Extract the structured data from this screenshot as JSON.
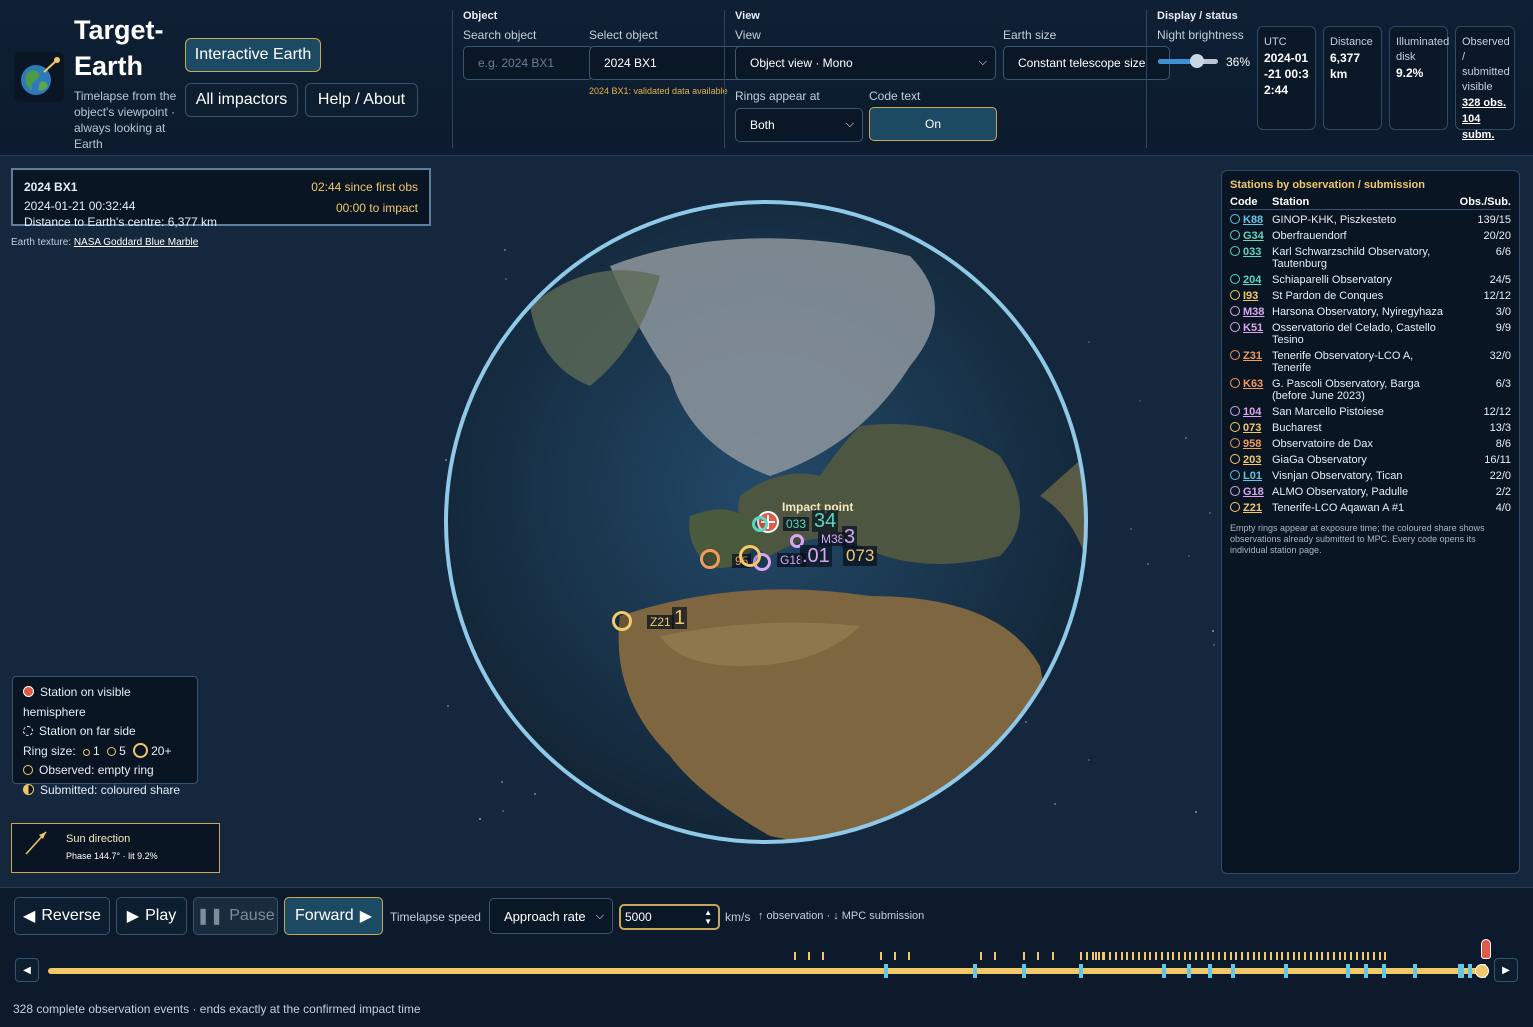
{
  "app": {
    "title": "Target-Earth",
    "subtitle": "Timelapse from the object's viewpoint · always looking at Earth"
  },
  "nav": {
    "interactive_earth": "Interactive Earth",
    "all_impactors": "All impactors",
    "help_about": "Help / About"
  },
  "object_section": {
    "title": "Object",
    "search_label": "Search object",
    "search_placeholder": "e.g. 2024 BX1",
    "select_label": "Select object",
    "select_value": "2024 BX1",
    "validated_note": "2024 BX1: validated data available"
  },
  "view_section": {
    "title": "View",
    "view_label": "View",
    "view_value": "Object view · Mono",
    "earth_size_label": "Earth size",
    "earth_size_value": "Constant telescope size",
    "rings_label": "Rings appear at",
    "rings_value": "Both",
    "code_text_label": "Code text",
    "code_text_value": "On"
  },
  "display_section": {
    "title": "Display / status",
    "night_brightness_label": "Night brightness",
    "night_brightness_value": "36%",
    "night_brightness_level": 0.36,
    "utc_label": "UTC",
    "utc_value": "2024-01-21 00:32:44",
    "distance_label": "Distance",
    "distance_value": "6,377 km",
    "illuminated_label": "Illuminated disk",
    "illuminated_value": "9.2%",
    "observed_label": "Observed / submitted visible",
    "observed_obs": "328 obs.",
    "observed_subm": "104 subm."
  },
  "infobox": {
    "object": "2024 BX1",
    "time": "2024-01-21 00:32:44",
    "distance": "Distance to Earth's centre: 6,377 km",
    "since_first": "02:44 since first obs",
    "to_impact": "00:00 to impact"
  },
  "texture": {
    "label": "Earth texture:",
    "link": "NASA Goddard Blue Marble"
  },
  "globe": {
    "impact_label": "Impact point",
    "markers": [
      {
        "code": "033",
        "color": "#5fd6c0",
        "big": "34"
      },
      {
        "code": "M38",
        "color": "#d9a7f0",
        "big": "3"
      },
      {
        "code": "95",
        "color": "#f39a5b",
        "big": ""
      },
      {
        "code": "G18",
        "color": "#d9a7f0",
        "big": ".01"
      },
      {
        "code": "073",
        "color": "#f3c96a",
        "big": ""
      },
      {
        "code": "Z21",
        "color": "#f3c96a",
        "big": "1"
      }
    ]
  },
  "legend": {
    "visible": "Station on visible hemisphere",
    "far": "Station on far side",
    "ring_size": "Ring size:",
    "sizes": [
      "1",
      "5",
      "20+"
    ],
    "observed": "Observed: empty ring",
    "submitted": "Submitted: coloured share"
  },
  "sun": {
    "title": "Sun direction",
    "detail": "Phase 144.7° · lit 9.2%"
  },
  "stations": {
    "title": "Stations by observation / submission",
    "headers": [
      "Code",
      "Station",
      "Obs./Sub."
    ],
    "rows": [
      {
        "code": "K88",
        "name": "GINOP-KHK, Piszkesteto",
        "obs": "139/15",
        "color": "#5ec8e6"
      },
      {
        "code": "G34",
        "name": "Oberfrauendorf",
        "obs": "20/20",
        "color": "#5fd6c0"
      },
      {
        "code": "033",
        "name": "Karl Schwarzschild Observatory, Tautenburg",
        "obs": "6/6",
        "color": "#5fd6c0"
      },
      {
        "code": "204",
        "name": "Schiaparelli Observatory",
        "obs": "24/5",
        "color": "#5fd6c0"
      },
      {
        "code": "I93",
        "name": "St Pardon de Conques",
        "obs": "12/12",
        "color": "#f3c96a"
      },
      {
        "code": "M38",
        "name": "Harsona Observatory, Nyiregyhaza",
        "obs": "3/0",
        "color": "#d9a7f0"
      },
      {
        "code": "K51",
        "name": "Osservatorio del Celado, Castello Tesino",
        "obs": "9/9",
        "color": "#d9a7f0"
      },
      {
        "code": "Z31",
        "name": "Tenerife Observatory-LCO A, Tenerife",
        "obs": "32/0",
        "color": "#f39a5b"
      },
      {
        "code": "K63",
        "name": "G. Pascoli Observatory, Barga (before June 2023)",
        "obs": "6/3",
        "color": "#f39a5b"
      },
      {
        "code": "104",
        "name": "San Marcello Pistoiese",
        "obs": "12/12",
        "color": "#d9a7f0"
      },
      {
        "code": "073",
        "name": "Bucharest",
        "obs": "13/3",
        "color": "#f3c96a"
      },
      {
        "code": "958",
        "name": "Observatoire de Dax",
        "obs": "8/6",
        "color": "#f39a5b"
      },
      {
        "code": "203",
        "name": "GiaGa Observatory",
        "obs": "16/11",
        "color": "#f3c96a"
      },
      {
        "code": "L01",
        "name": "Visnjan Observatory, Tican",
        "obs": "22/0",
        "color": "#5ec8e6"
      },
      {
        "code": "G18",
        "name": "ALMO Observatory, Padulle",
        "obs": "2/2",
        "color": "#d9a7f0"
      },
      {
        "code": "Z21",
        "name": "Tenerife-LCO Aqawan A #1",
        "obs": "4/0",
        "color": "#f3c96a"
      }
    ],
    "note": "Empty rings appear at exposure time; the coloured share shows observations already submitted to MPC. Every code opens its individual station page."
  },
  "controls": {
    "reverse": "Reverse",
    "play": "Play",
    "pause": "Pause",
    "forward": "Forward",
    "speed_label": "Timelapse speed",
    "speed_mode": "Approach rate",
    "speed_value": "5000",
    "speed_unit": "km/s",
    "tick_legend": "↑ observation · ↓ MPC submission",
    "timeline_progress": 1.0
  },
  "footer": "328 complete observation events · ends exactly at the confirmed impact time",
  "colors": {
    "accent_gold": "#c9a75a",
    "active_bg": "#1d4a63",
    "timeline_obs": "#f0c869",
    "timeline_sub": "#5ec8e6",
    "impact_red": "#e05a4a"
  }
}
